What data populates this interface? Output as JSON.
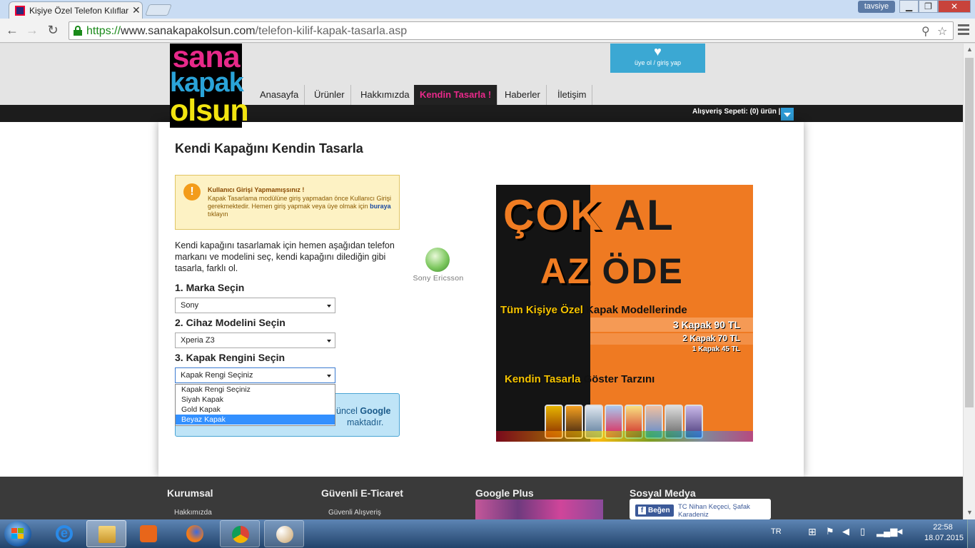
{
  "browser": {
    "tab_title": "Kişiye Özel Telefon Kılıfları",
    "tab_close": "✕",
    "tavsiye_label": "tavsiye",
    "url_scheme": "https://",
    "url_host": "www.sanakapakolsun.com",
    "url_path": "/telefon-kilif-kapak-tasarla.asp",
    "back_icon": "←",
    "forward_icon": "→",
    "reload_icon": "↻",
    "zoom_icon": "⚲",
    "star_icon": "☆"
  },
  "site": {
    "logo_line1": "sana",
    "logo_line2": "kapak",
    "logo_line3": "olsun",
    "nav": [
      "Anasayfa",
      "Ürünler",
      "Hakkımızda",
      "Kendin Tasarla !",
      "Haberler",
      "İletişim"
    ],
    "active_nav": "Kendin Tasarla !",
    "login_label": "üye ol / giriş yap",
    "cart_text": "Alışveriş Sepeti: (0) ürün  |"
  },
  "main": {
    "title": "Kendi Kapağını Kendin Tasarla",
    "warning_title": "Kullanıcı Girişi Yapmamışsınız !",
    "warning_text_1": "Kapak Tasarlama modülüne giriş yapmadan önce Kullanıcı Girişi gerekmektedir. Hemen giriş yapmak veya üye olmak için ",
    "warning_link": "buraya",
    "warning_text_2": " tıklayın",
    "intro": "Kendi kapağını tasarlamak için hemen aşağıdan telefon markanı ve modelini seç, kendi kapağını dilediğin gibi tasarla, farklı ol.",
    "step1_label": "1. Marka Seçin",
    "step1_value": "Sony",
    "step2_label": "2. Cihaz Modelini Seçin",
    "step2_value": "Xperia Z3",
    "step3_label": "3. Kapak Rengini Seçin",
    "step3_value": "Kapak Rengi Seçiniz",
    "color_options": [
      "Kapak Rengi Seçiniz",
      "Siyah Kapak",
      "Gold Kapak",
      "Beyaz Kapak"
    ],
    "highlighted_option": "Beyaz Kapak",
    "info_line1_pre": "üncel ",
    "info_line1_bold": "Google",
    "info_line2": "maktadır.",
    "brand_logo_text": "Sony Ericsson"
  },
  "banner": {
    "headline1_a": "ÇOK",
    "headline1_b": " AL",
    "headline2_a": "AZ",
    "headline2_b": " ÖDE",
    "subline_a": "Tüm Kişiye Özel",
    "subline_b": " Kapak Modellerinde",
    "price1": "3 Kapak 90 TL",
    "price2": "2 Kapak 70 TL",
    "price3": "1 Kapak 45 TL",
    "slogan_a": "Kendin Tasarla",
    "slogan_b": " Göster Tarzını"
  },
  "footer": {
    "col1_title": "Kurumsal",
    "col1_link": "Hakkımızda",
    "col2_title": "Güvenli E-Ticaret",
    "col2_link": "Güvenli Alışveriş",
    "col3_title": "Google Plus",
    "col4_title": "Sosyal Medya",
    "fb_button": "Beğen",
    "fb_text": "TC Nihan Keçeci, Şafak Karadeniz"
  },
  "taskbar": {
    "lang": "TR",
    "time": "22:58",
    "date": "18.07.2015"
  },
  "colors": {
    "brand_pink": "#e8298a",
    "brand_blue": "#2aa3d8",
    "brand_yellow": "#f2e410",
    "banner_orange": "#ef7a22"
  }
}
